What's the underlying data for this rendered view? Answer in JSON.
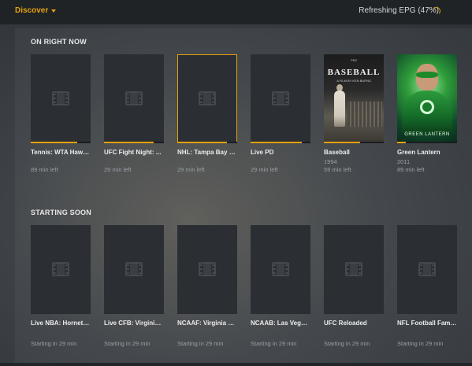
{
  "header": {
    "discover_label": "Discover",
    "status_text": "Refreshing EPG (47%)"
  },
  "sections": [
    {
      "title": "ON RIGHT NOW",
      "cards": [
        {
          "title": "Tennis: WTA Hawa...",
          "year": "",
          "time": "89 min left",
          "progress": 0.78,
          "art": "placeholder",
          "selected": false
        },
        {
          "title": "UFC Fight Night: ...",
          "year": "",
          "time": "29 min left",
          "progress": 0.83,
          "art": "placeholder",
          "selected": false
        },
        {
          "title": "NHL: Tampa Bay L...",
          "year": "",
          "time": "29 min left",
          "progress": 0.83,
          "art": "placeholder",
          "selected": true
        },
        {
          "title": "Live PD",
          "year": "",
          "time": "29 min left",
          "progress": 0.85,
          "art": "placeholder",
          "selected": false
        },
        {
          "title": "Baseball",
          "year": "1994",
          "time": "59 min left",
          "progress": 0.6,
          "art": "baseball",
          "selected": false
        },
        {
          "title": "Green Lantern",
          "year": "2011",
          "time": "89 min left",
          "progress": 0.15,
          "art": "greenlantern",
          "selected": false
        }
      ]
    },
    {
      "title": "STARTING SOON",
      "cards": [
        {
          "title": "Live NBA: Hornets...",
          "time": "Starting in 29 min"
        },
        {
          "title": "Live CFB: Virginia ...",
          "time": "Starting in 29 min"
        },
        {
          "title": "NCAAF: Virginia Te...",
          "time": "Starting in 29 min"
        },
        {
          "title": "NCAAB: Las Vegas ...",
          "time": "Starting in 29 min"
        },
        {
          "title": "UFC Reloaded",
          "time": "Starting in 29 min"
        },
        {
          "title": "NFL Football Fami...",
          "time": "Starting in 29 min"
        }
      ]
    }
  ],
  "poster_text": {
    "baseball": {
      "top": "PBS",
      "title": "BASEBALL",
      "sub": "A FILM BY KEN BURNS",
      "bottom": ""
    },
    "greenlantern": {
      "title": "GREEN LANTERN"
    }
  },
  "colors": {
    "accent": "#e5a00d",
    "card_bg": "#2b2f33"
  },
  "icons": {
    "placeholder": "film-icon",
    "dropdown": "chevron-down-icon",
    "status": "spinner-icon"
  }
}
